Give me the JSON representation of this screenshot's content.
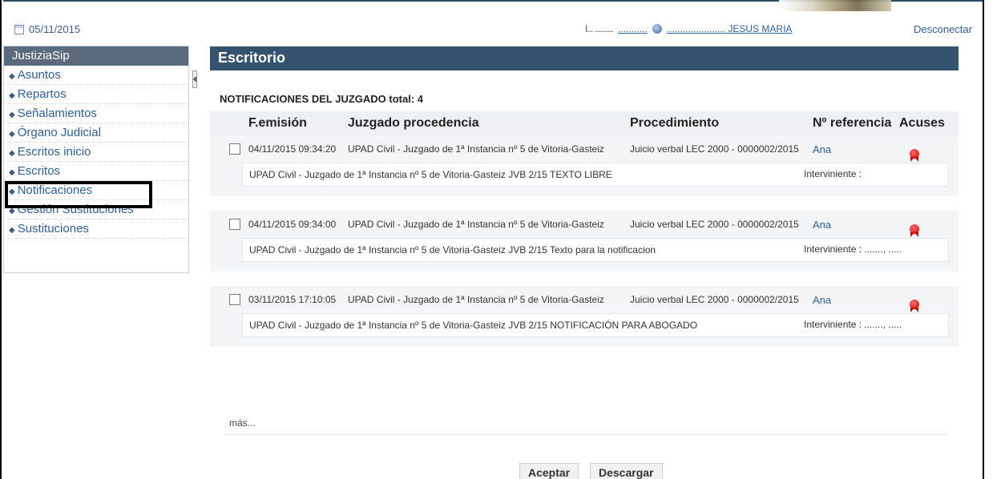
{
  "header": {
    "date": "05/11/2015",
    "user_code": "I... ..........",
    "user_link1": "...........",
    "user_name": "...................... JESUS MARIA",
    "disconnect": "Desconectar"
  },
  "sidebar": {
    "title": "JustiziaSip",
    "items": [
      {
        "label": "Asuntos"
      },
      {
        "label": "Repartos"
      },
      {
        "label": "Señalamientos"
      },
      {
        "label": "Órgano Judicial"
      },
      {
        "label": "Escritos inicio"
      },
      {
        "label": "Escritos"
      },
      {
        "label": "Notificaciones"
      },
      {
        "label": "Gestión Sustituciones"
      },
      {
        "label": "Sustituciones"
      }
    ]
  },
  "main": {
    "title": "Escritorio",
    "section_title": "NOTIFICACIONES DEL JUZGADO total: 4",
    "columns": [
      "F.emisión",
      "Juzgado procedencia",
      "Procedimiento",
      "Nº referencia",
      "Acuses"
    ],
    "rows": [
      {
        "date": "04/11/2015 09:34:20",
        "court": "UPAD Civil - Juzgado de 1ª Instancia nº 5 de Vitoria-Gasteiz",
        "procedure": "Juicio verbal LEC 2000 - 0000002/2015",
        "reference": "Ana",
        "detail": "UPAD Civil - Juzgado de 1ª Instancia nº 5 de Vitoria-Gasteiz   JVB 2/15   TEXTO LIBRE",
        "intervener": "Interviniente :"
      },
      {
        "date": "04/11/2015 09:34:00",
        "court": "UPAD Civil - Juzgado de 1ª Instancia nº 5 de Vitoria-Gasteiz",
        "procedure": "Juicio verbal LEC 2000 - 0000002/2015",
        "reference": "Ana",
        "detail": "UPAD Civil - Juzgado de 1ª Instancia nº 5 de Vitoria-Gasteiz   JVB 2/15   Texto para la notificacion",
        "intervener": "Interviniente : ......., ....."
      },
      {
        "date": "03/11/2015 17:10:05",
        "court": "UPAD Civil - Juzgado de 1ª Instancia nº 5 de Vitoria-Gasteiz",
        "procedure": "Juicio verbal LEC 2000 - 0000002/2015",
        "reference": "Ana",
        "detail": "UPAD Civil - Juzgado de 1ª Instancia nº 5 de Vitoria-Gasteiz   JVB 2/15   NOTIFICACIÓN PARA ABOGADO",
        "intervener": "Interviniente : ......., ....."
      }
    ],
    "more": "más...",
    "buttons": {
      "accept": "Aceptar",
      "download": "Descargar"
    }
  },
  "icons": {
    "calendar": "calendar-icon",
    "user": "user-icon",
    "acuse": "acuse-ribbon-icon",
    "collapse": "collapse-arrow-icon"
  },
  "colors": {
    "header_bar": "#33536f",
    "sidebar_head": "#5b6b7d",
    "link": "#2c5f9e",
    "acuse": "#c80000"
  }
}
